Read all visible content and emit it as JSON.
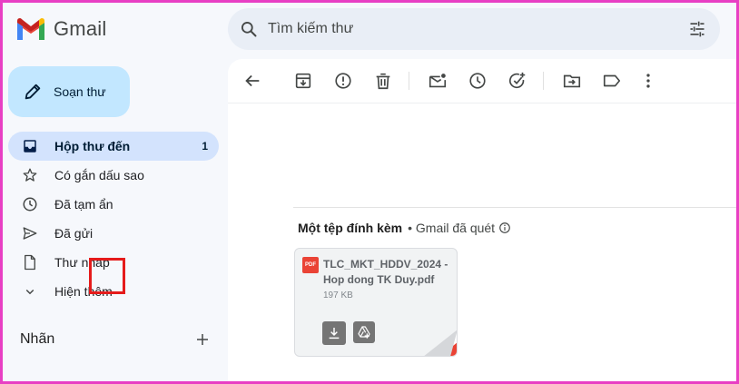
{
  "app": {
    "name": "Gmail"
  },
  "search": {
    "placeholder": "Tìm kiếm thư"
  },
  "compose": {
    "label": "Soạn thư"
  },
  "sidebar": {
    "items": [
      {
        "label": "Hộp thư đến",
        "count": "1",
        "icon": "inbox-icon",
        "active": true
      },
      {
        "label": "Có gắn dấu sao",
        "count": "",
        "icon": "star-icon"
      },
      {
        "label": "Đã tạm ẩn",
        "count": "",
        "icon": "clock-icon"
      },
      {
        "label": "Đã gửi",
        "count": "",
        "icon": "send-icon"
      },
      {
        "label": "Thư nháp",
        "count": "",
        "icon": "draft-icon"
      },
      {
        "label": "Hiện thêm",
        "count": "",
        "icon": "chevron-down-icon"
      }
    ],
    "labels_title": "Nhãn"
  },
  "attachments": {
    "heading": "Một tệp đính kèm",
    "scanned": "• Gmail đã quét",
    "file": {
      "name": "TLC_MKT_HDDV_2024 - Hop dong TK Duy.pdf",
      "size": "197 KB",
      "type_badge": "PDF"
    }
  },
  "colors": {
    "accent": "#c2e7ff",
    "active_nav": "#d3e3fd",
    "frame": "#e83fc4",
    "highlight": "#e51b1b",
    "pdf": "#ea4335"
  }
}
